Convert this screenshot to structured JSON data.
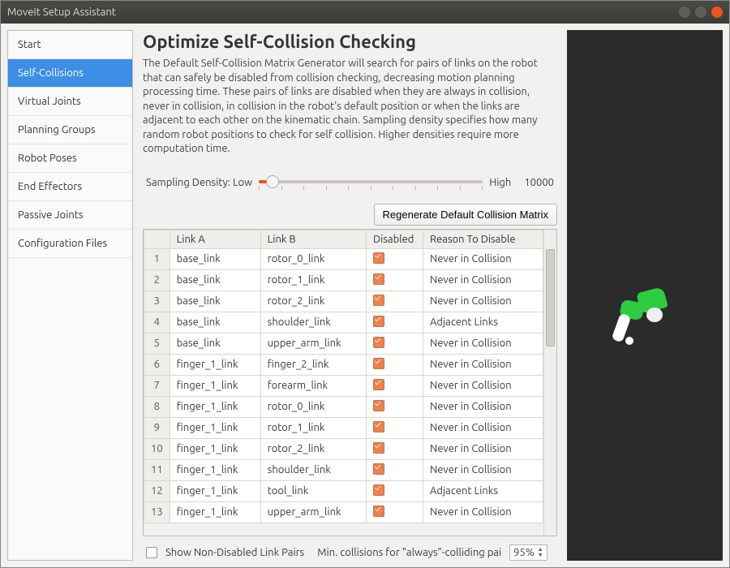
{
  "window": {
    "title": "MoveIt Setup Assistant"
  },
  "sidebar": {
    "items": [
      {
        "label": "Start"
      },
      {
        "label": "Self-Collisions"
      },
      {
        "label": "Virtual Joints"
      },
      {
        "label": "Planning Groups"
      },
      {
        "label": "Robot Poses"
      },
      {
        "label": "End Effectors"
      },
      {
        "label": "Passive Joints"
      },
      {
        "label": "Configuration Files"
      }
    ],
    "active_index": 1
  },
  "page": {
    "title": "Optimize Self-Collision Checking",
    "description": "The Default Self-Collision Matrix Generator will search for pairs of links on the robot that can safely be disabled from collision checking, decreasing motion planning processing time. These pairs of links are disabled when they are always in collision, never in collision, in collision in the robot's default position or when the links are adjacent to each other on the kinematic chain. Sampling density specifies how many random robot positions to check for self collision. Higher densities require more computation time."
  },
  "density": {
    "label": "Sampling Density: Low",
    "high_label": "High",
    "value": "10000"
  },
  "regen_button": "Regenerate Default Collision Matrix",
  "table": {
    "columns": {
      "linkA": "Link A",
      "linkB": "Link B",
      "disabled": "Disabled",
      "reason": "Reason To Disable"
    },
    "rows": [
      {
        "n": "1",
        "a": "base_link",
        "b": "rotor_0_link",
        "disabled": true,
        "reason": "Never in Collision"
      },
      {
        "n": "2",
        "a": "base_link",
        "b": "rotor_1_link",
        "disabled": true,
        "reason": "Never in Collision"
      },
      {
        "n": "3",
        "a": "base_link",
        "b": "rotor_2_link",
        "disabled": true,
        "reason": "Never in Collision"
      },
      {
        "n": "4",
        "a": "base_link",
        "b": "shoulder_link",
        "disabled": true,
        "reason": "Adjacent Links"
      },
      {
        "n": "5",
        "a": "base_link",
        "b": "upper_arm_link",
        "disabled": true,
        "reason": "Never in Collision"
      },
      {
        "n": "6",
        "a": "finger_1_link",
        "b": "finger_2_link",
        "disabled": true,
        "reason": "Never in Collision"
      },
      {
        "n": "7",
        "a": "finger_1_link",
        "b": "forearm_link",
        "disabled": true,
        "reason": "Never in Collision"
      },
      {
        "n": "8",
        "a": "finger_1_link",
        "b": "rotor_0_link",
        "disabled": true,
        "reason": "Never in Collision"
      },
      {
        "n": "9",
        "a": "finger_1_link",
        "b": "rotor_1_link",
        "disabled": true,
        "reason": "Never in Collision"
      },
      {
        "n": "10",
        "a": "finger_1_link",
        "b": "rotor_2_link",
        "disabled": true,
        "reason": "Never in Collision"
      },
      {
        "n": "11",
        "a": "finger_1_link",
        "b": "shoulder_link",
        "disabled": true,
        "reason": "Never in Collision"
      },
      {
        "n": "12",
        "a": "finger_1_link",
        "b": "tool_link",
        "disabled": true,
        "reason": "Adjacent Links"
      },
      {
        "n": "13",
        "a": "finger_1_link",
        "b": "upper_arm_link",
        "disabled": true,
        "reason": "Never in Collision"
      }
    ]
  },
  "footer": {
    "show_non_disabled_label": "Show Non-Disabled Link Pairs",
    "show_non_disabled_checked": false,
    "min_collisions_label": "Min. collisions for \"always\"-colliding pai",
    "min_collisions_value": "95%"
  }
}
